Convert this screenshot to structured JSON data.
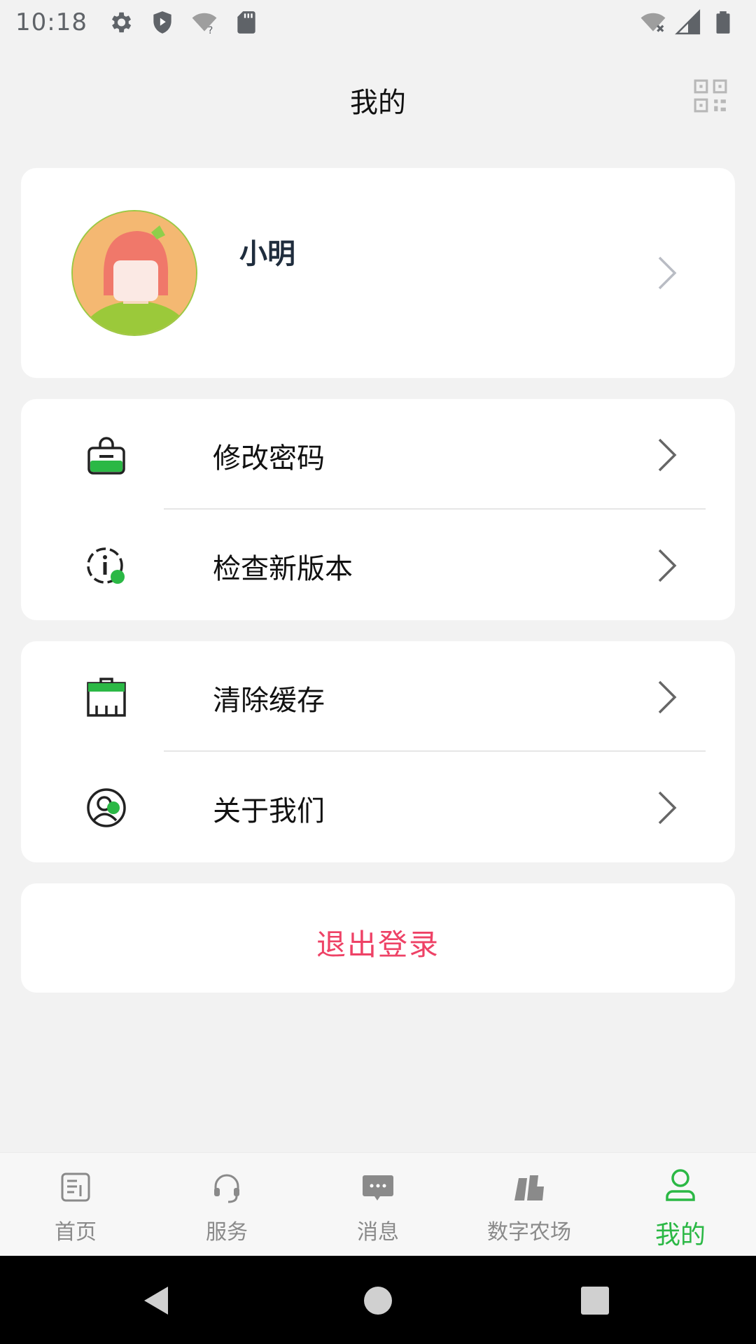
{
  "status_bar": {
    "time": "10:18",
    "icons": [
      "settings-icon",
      "shield-play-icon",
      "wifi-question-icon",
      "sd-card-icon"
    ],
    "right_icons": [
      "wifi-off-icon",
      "signal-icon",
      "battery-icon"
    ]
  },
  "header": {
    "title": "我的",
    "qr_icon": "qr-code-icon"
  },
  "profile": {
    "name": "小明",
    "avatar_icon": "avatar-icon"
  },
  "menu_group_1": [
    {
      "label": "修改密码",
      "icon": "lock-icon"
    },
    {
      "label": "检查新版本",
      "icon": "info-update-icon"
    }
  ],
  "menu_group_2": [
    {
      "label": "清除缓存",
      "icon": "clear-cache-icon"
    },
    {
      "label": "关于我们",
      "icon": "about-user-icon"
    }
  ],
  "logout": {
    "label": "退出登录"
  },
  "tabbar": {
    "active": 4,
    "items": [
      {
        "label": "首页",
        "icon": "home-doc-icon"
      },
      {
        "label": "服务",
        "icon": "headset-icon"
      },
      {
        "label": "消息",
        "icon": "message-icon"
      },
      {
        "label": "数字农场",
        "icon": "farm-icon"
      },
      {
        "label": "我的",
        "icon": "user-icon"
      }
    ]
  },
  "colors": {
    "accent_green": "#2bb845",
    "logout_red": "#ee4266",
    "background": "#f2f2f2",
    "inactive_gray": "#8a8a8a"
  }
}
